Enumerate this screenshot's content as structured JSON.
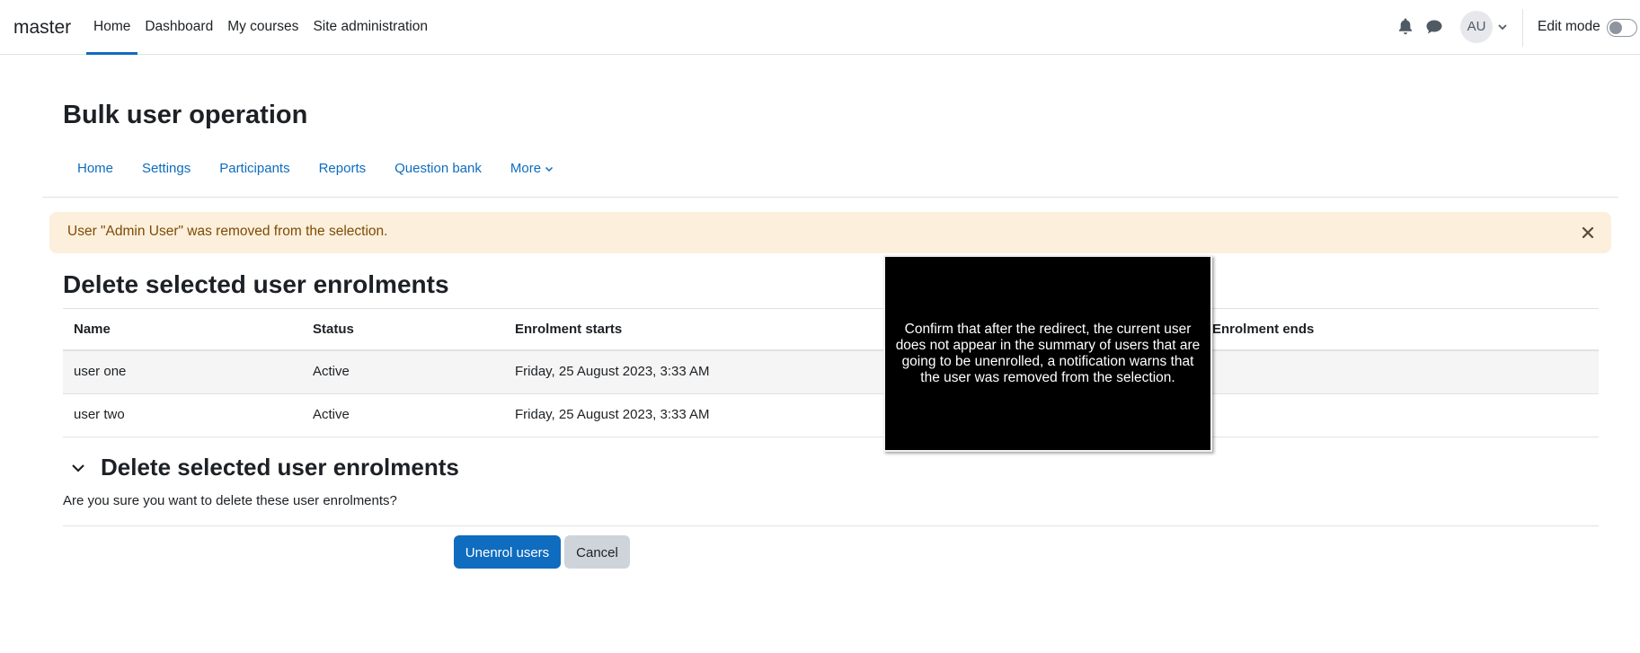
{
  "navbar": {
    "brand": "master",
    "items": [
      {
        "label": "Home",
        "active": true
      },
      {
        "label": "Dashboard",
        "active": false
      },
      {
        "label": "My courses",
        "active": false
      },
      {
        "label": "Site administration",
        "active": false
      }
    ],
    "avatar_initials": "AU",
    "edit_mode_label": "Edit mode",
    "edit_mode_on": false,
    "icons": [
      "bell-icon",
      "chat-icon",
      "chevron-down-icon"
    ]
  },
  "page": {
    "title": "Bulk user operation"
  },
  "secondary_nav": {
    "items": [
      "Home",
      "Settings",
      "Participants",
      "Reports",
      "Question bank"
    ],
    "more_label": "More"
  },
  "alert": {
    "text": "User \"Admin User\" was removed from the selection.",
    "close_icon": "close-icon"
  },
  "section": {
    "heading": "Delete selected user enrolments"
  },
  "table": {
    "columns": [
      "Name",
      "Status",
      "Enrolment starts",
      "Enrolment ends"
    ],
    "rows": [
      {
        "name": "user one",
        "status": "Active",
        "starts": "Friday, 25 August 2023, 3:33 AM",
        "ends": ""
      },
      {
        "name": "user two",
        "status": "Active",
        "starts": "Friday, 25 August 2023, 3:33 AM",
        "ends": ""
      }
    ]
  },
  "form": {
    "heading": "Delete selected user enrolments",
    "question": "Are you sure you want to delete these user enrolments?",
    "submit_label": "Unenrol users",
    "cancel_label": "Cancel"
  },
  "annotation": {
    "text": "Confirm that after the redirect, the current user does not appear in the summary of users that are going to be unenrolled, a notification warns that the user was removed from the selection."
  },
  "colors": {
    "accent": "#0f6cbf",
    "alert_bg": "#fcefdc",
    "alert_text": "#7d4b05"
  }
}
